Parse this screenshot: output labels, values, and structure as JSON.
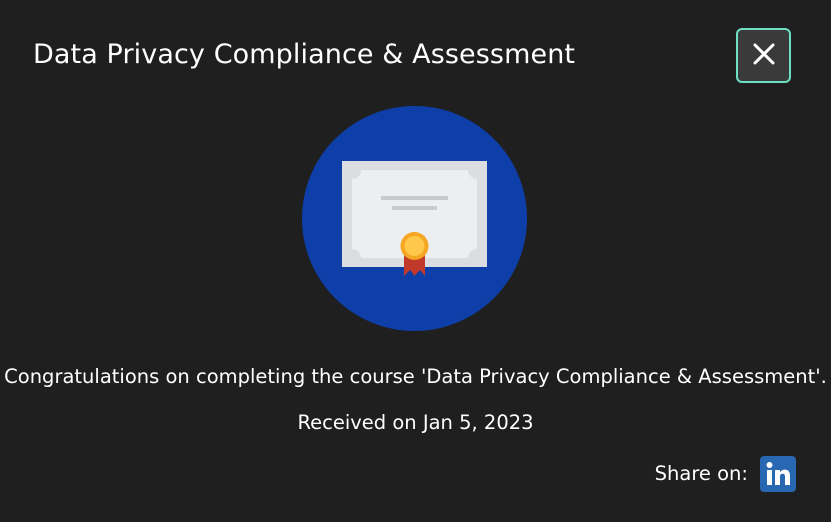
{
  "dialog": {
    "title": "Data Privacy Compliance & Assessment",
    "close_icon": "close-icon",
    "badge_icon": "certificate-icon",
    "message": "Congratulations on completing the course 'Data Privacy Compliance & Assessment'.",
    "received": "Received on Jan 5, 2023",
    "share_label": "Share on:",
    "share_icon": "linkedin-icon"
  },
  "colors": {
    "background": "#1f1f1f",
    "badge_circle": "#0e3fa8",
    "close_border": "#6ee0c2",
    "linkedin": "#2867b2"
  }
}
